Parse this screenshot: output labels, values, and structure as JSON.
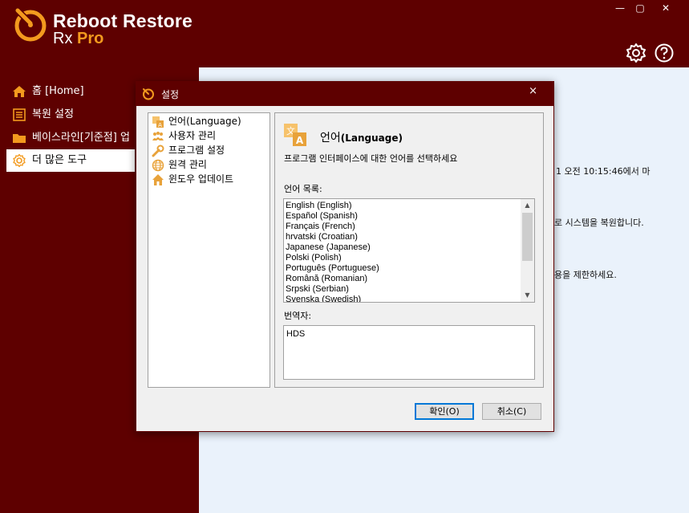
{
  "brand": {
    "line1": "Reboot Restore",
    "line2_prefix": "Rx",
    "line2_suffix": "Pro"
  },
  "window_controls": {
    "minimize": "—",
    "maximize": "▢",
    "close": "✕"
  },
  "sidebar": {
    "items": [
      {
        "label": "홈 [Home]",
        "icon": "home-icon"
      },
      {
        "label": "복원 설정",
        "icon": "list-icon"
      },
      {
        "label": "베이스라인[기준점] 업",
        "icon": "folder-icon"
      },
      {
        "label": "더 많은 도구",
        "icon": "gear-icon"
      }
    ],
    "active_index": 3
  },
  "main": {
    "text1": "1 오전 10:15:46에서 마",
    "text2": "로 시스템을 복원합니다.",
    "text3": "용을 제한하세요."
  },
  "dialog": {
    "title": "설정",
    "close": "×",
    "tree": [
      {
        "label": "언어(Language)",
        "icon": "language-icon"
      },
      {
        "label": "사용자 관리",
        "icon": "users-icon"
      },
      {
        "label": "프로그램 설정",
        "icon": "wrench-icon"
      },
      {
        "label": "원격 관리",
        "icon": "globe-icon"
      },
      {
        "label": "윈도우 업데이트",
        "icon": "house-icon"
      }
    ],
    "panel": {
      "title_ko": "언어",
      "title_en": "(Language)",
      "description": "프로그램 인터페이스에 대한 언어를 선택하세요",
      "list_label": "언어 목록:",
      "languages": [
        "English (English)",
        "Español (Spanish)",
        "Français (French)",
        "hrvatski (Croatian)",
        "Japanese (Japanese)",
        "Polski (Polish)",
        "Português (Portuguese)",
        "Română (Romanian)",
        "Srpski (Serbian)",
        "Svenska (Swedish)"
      ],
      "translator_label": "번역자:",
      "translator_value": "HDS"
    },
    "buttons": {
      "ok": "확인(O)",
      "cancel": "취소(C)"
    }
  },
  "colors": {
    "maroon": "#5e0000",
    "accent_orange": "#f39a1e",
    "main_bg": "#eaf2fb"
  }
}
